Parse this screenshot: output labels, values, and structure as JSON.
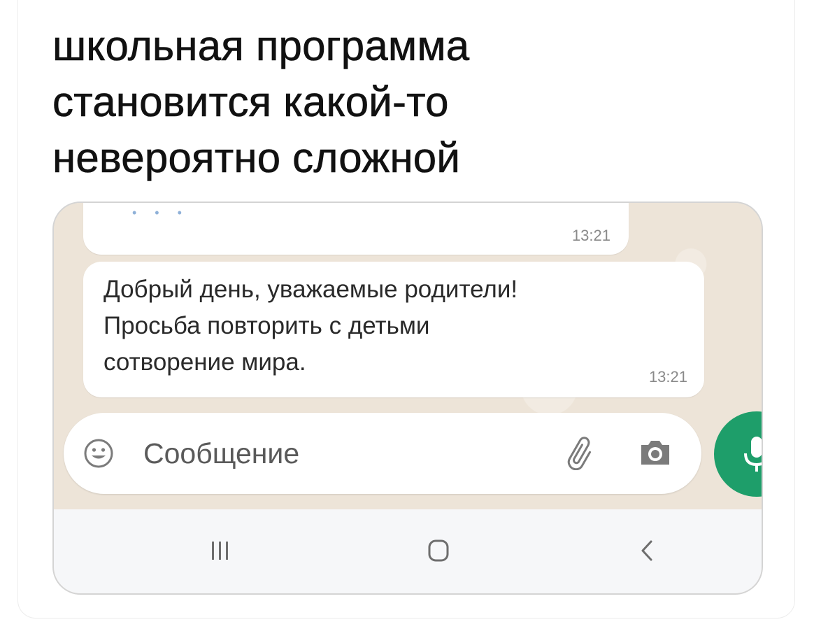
{
  "caption": {
    "lines": [
      "школьная программа",
      "становится какой-то",
      "невероятно сложной"
    ]
  },
  "chat": {
    "previous_message": {
      "time": "13:21"
    },
    "message": {
      "text": "Добрый день, уважаемые родители!\nПросьба повторить с детьми\nсотворение мира.",
      "time": "13:21"
    }
  },
  "composer": {
    "placeholder": "Сообщение",
    "icons": [
      "emoji-icon",
      "paperclip-icon",
      "camera-icon",
      "microphone-icon"
    ],
    "accent_color": "#1e9e6a"
  },
  "navigation": {
    "icons": [
      "recent-apps-icon",
      "home-icon",
      "back-icon"
    ]
  }
}
